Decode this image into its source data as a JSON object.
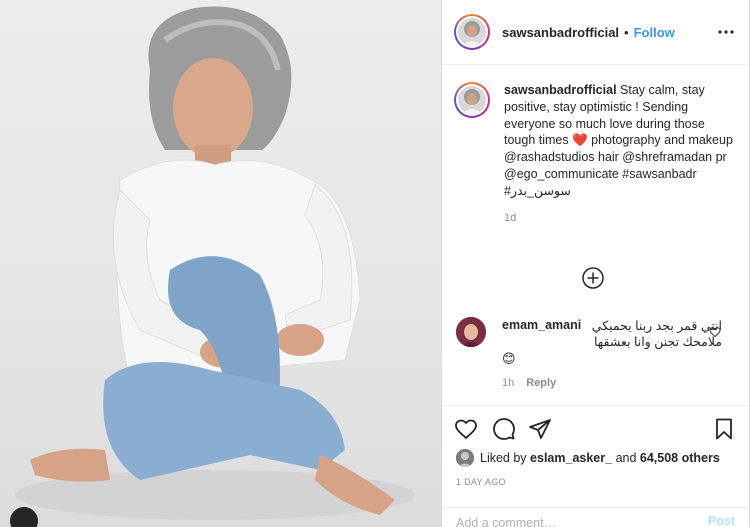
{
  "post": {
    "username": "sawsanbadrofficial",
    "separator": "•",
    "follow_label": "Follow"
  },
  "caption": {
    "username": "sawsanbadrofficial",
    "text_1": " Stay calm, stay positive, stay optimistic ! Sending everyone so much love during those tough times ",
    "heart": "❤️",
    "text_2": " photography and makeup @rashadstudios hair @shreframadan pr @ego_communicate #sawsanbadr #سوسن_بدر",
    "age": "1d"
  },
  "comment": {
    "username": "emam_amani",
    "text": "انتي قمر بجد ربنا يحميكي ملامحك تجنن وانا بعشقها",
    "emoji": "😊",
    "age": "1h",
    "reply_label": "Reply"
  },
  "likes": {
    "prefix": "Liked by ",
    "user": "eslam_asker_",
    "and": " and ",
    "count": "64,508 others"
  },
  "post_age": "1 DAY AGO",
  "add_comment": {
    "placeholder": "Add a comment…",
    "post_label": "Post"
  },
  "icons": {
    "header_avatar": "profile-avatar-icon",
    "more": "more-options-icon",
    "load_more": "plus-circle-icon",
    "comment_like": "heart-outline-icon",
    "like": "heart-outline-icon",
    "comment": "comment-bubble-icon",
    "share": "paper-plane-icon",
    "save": "bookmark-icon"
  },
  "colors": {
    "accent": "#3897f0",
    "text": "#262626",
    "muted": "#8e8e8e"
  }
}
